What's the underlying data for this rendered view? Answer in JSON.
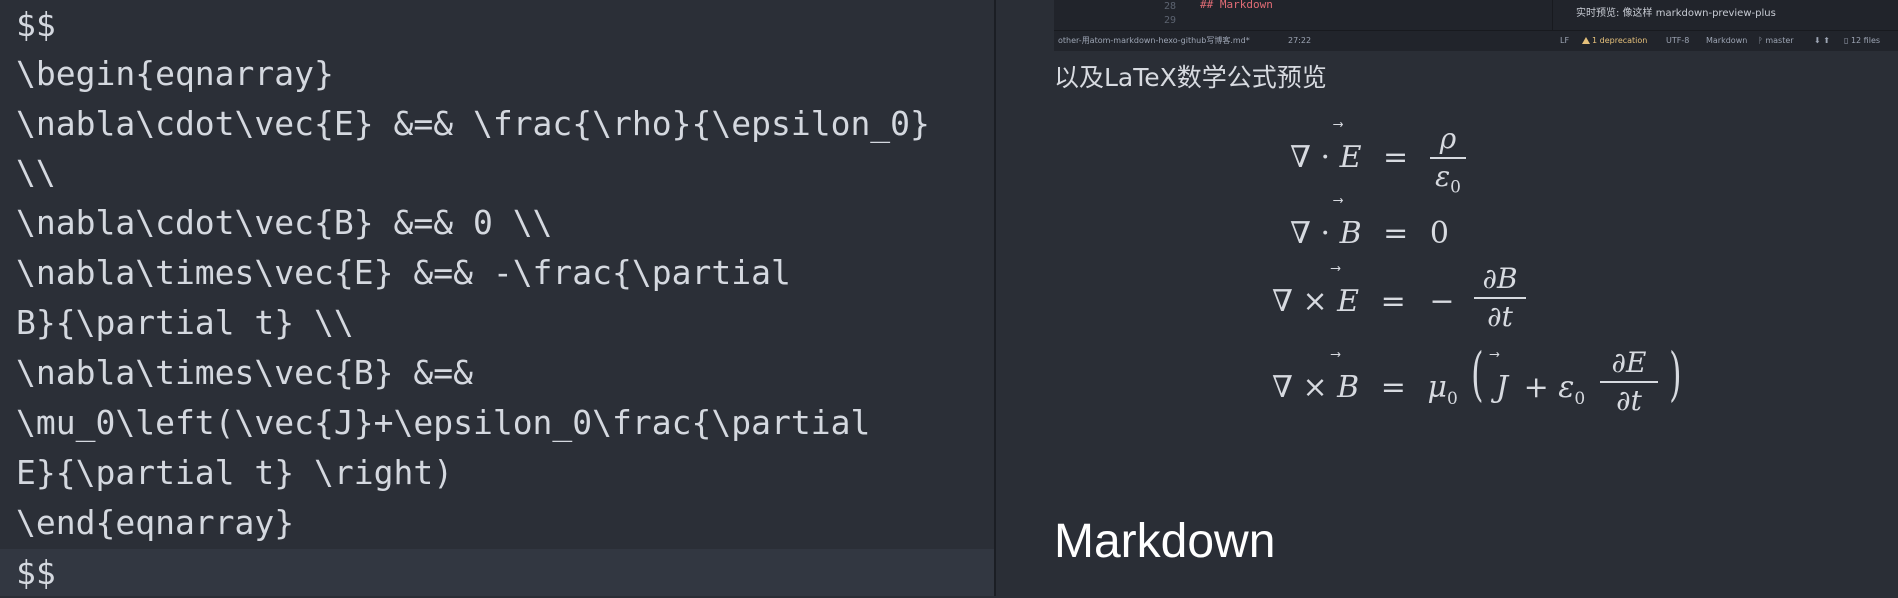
{
  "editor": {
    "lines": [
      "$$",
      "\\begin{eqnarray}",
      "\\nabla\\cdot\\vec{E} &=& \\frac{\\rho}{\\epsilon_0}",
      "\\\\",
      "\\nabla\\cdot\\vec{B} &=& 0 \\\\",
      "\\nabla\\times\\vec{E} &=& -\\frac{\\partial",
      "B}{\\partial t} \\\\",
      "\\nabla\\times\\vec{B} &=&",
      "\\mu_0\\left(\\vec{J}+\\epsilon_0\\frac{\\partial",
      "E}{\\partial t} \\right)",
      "\\end{eqnarray}",
      "$$"
    ]
  },
  "embedded_screenshot": {
    "line_numbers": [
      "28",
      "29"
    ],
    "code_snippet": "## Markdown",
    "side_text": "实时预览:  像这样 markdown-preview-plus",
    "status": {
      "file": "other-用atom-markdown-hexo-github写博客.md*",
      "cursor": "27:22",
      "line_ending": "LF",
      "deprecation": "1 deprecation",
      "encoding": "UTF-8",
      "grammar": "Markdown",
      "branch": "master",
      "arrows": "⬇ ⬆",
      "files": "12 files"
    }
  },
  "preview": {
    "heading": "以及LaTeX数学公式预览",
    "equations": {
      "eq1": {
        "lhs_op": "∇ ·",
        "lhs_var": "E",
        "rel": "=",
        "num": "ρ",
        "den": "ε",
        "den_sub": "0"
      },
      "eq2": {
        "lhs_op": "∇ ·",
        "lhs_var": "B",
        "rel": "=",
        "rhs": "0"
      },
      "eq3": {
        "lhs_op": "∇ ×",
        "lhs_var": "E",
        "rel": "=",
        "sign": "−",
        "num": "∂B",
        "den": "∂t"
      },
      "eq4": {
        "lhs_op": "∇ ×",
        "lhs_var": "B",
        "rel": "=",
        "mu": "μ",
        "mu_sub": "0",
        "lparen": "(",
        "j": "J",
        "plus": "+",
        "eps": "ε",
        "eps_sub": "0",
        "num": "∂E",
        "den": "∂t",
        "rparen": ")"
      }
    },
    "markdown_heading": "Markdown"
  }
}
